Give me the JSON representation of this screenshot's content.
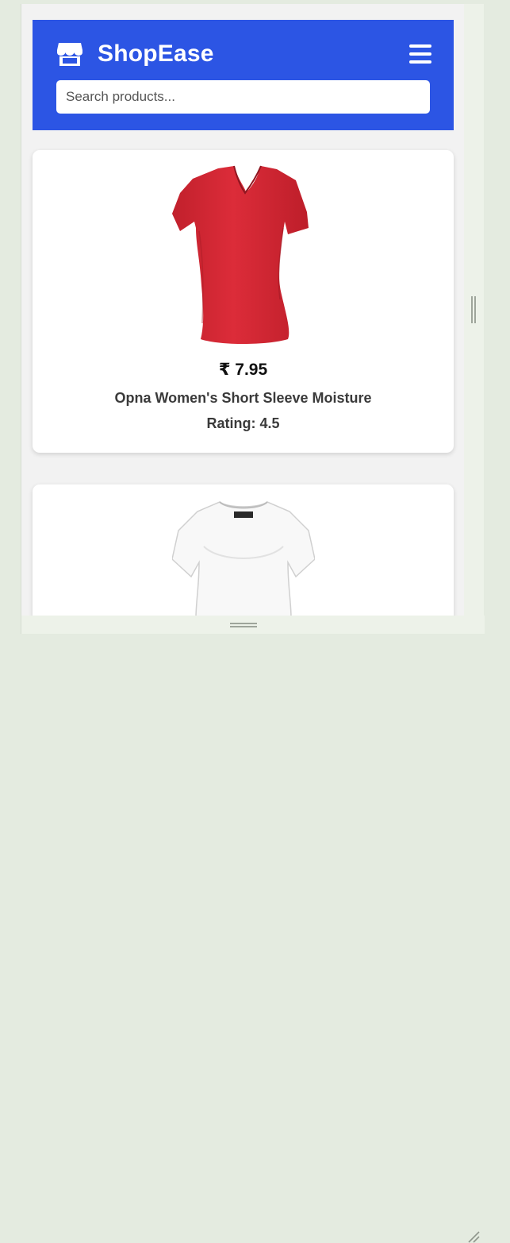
{
  "app": {
    "brand": "ShopEase",
    "brand_icon": "store-icon",
    "menu_icon": "hamburger-menu-icon",
    "accent_color": "#2c55e4"
  },
  "search": {
    "placeholder": "Search products...",
    "value": ""
  },
  "products": [
    {
      "price": "₹ 7.95",
      "title": "Opna Women's Short Sleeve Moisture",
      "rating": "Rating: 4.5",
      "image": "red-v-neck-tshirt",
      "image_color": "#d42a36"
    },
    {
      "image": "white-scoop-neck-top",
      "image_color": "#f7f7f7"
    }
  ]
}
